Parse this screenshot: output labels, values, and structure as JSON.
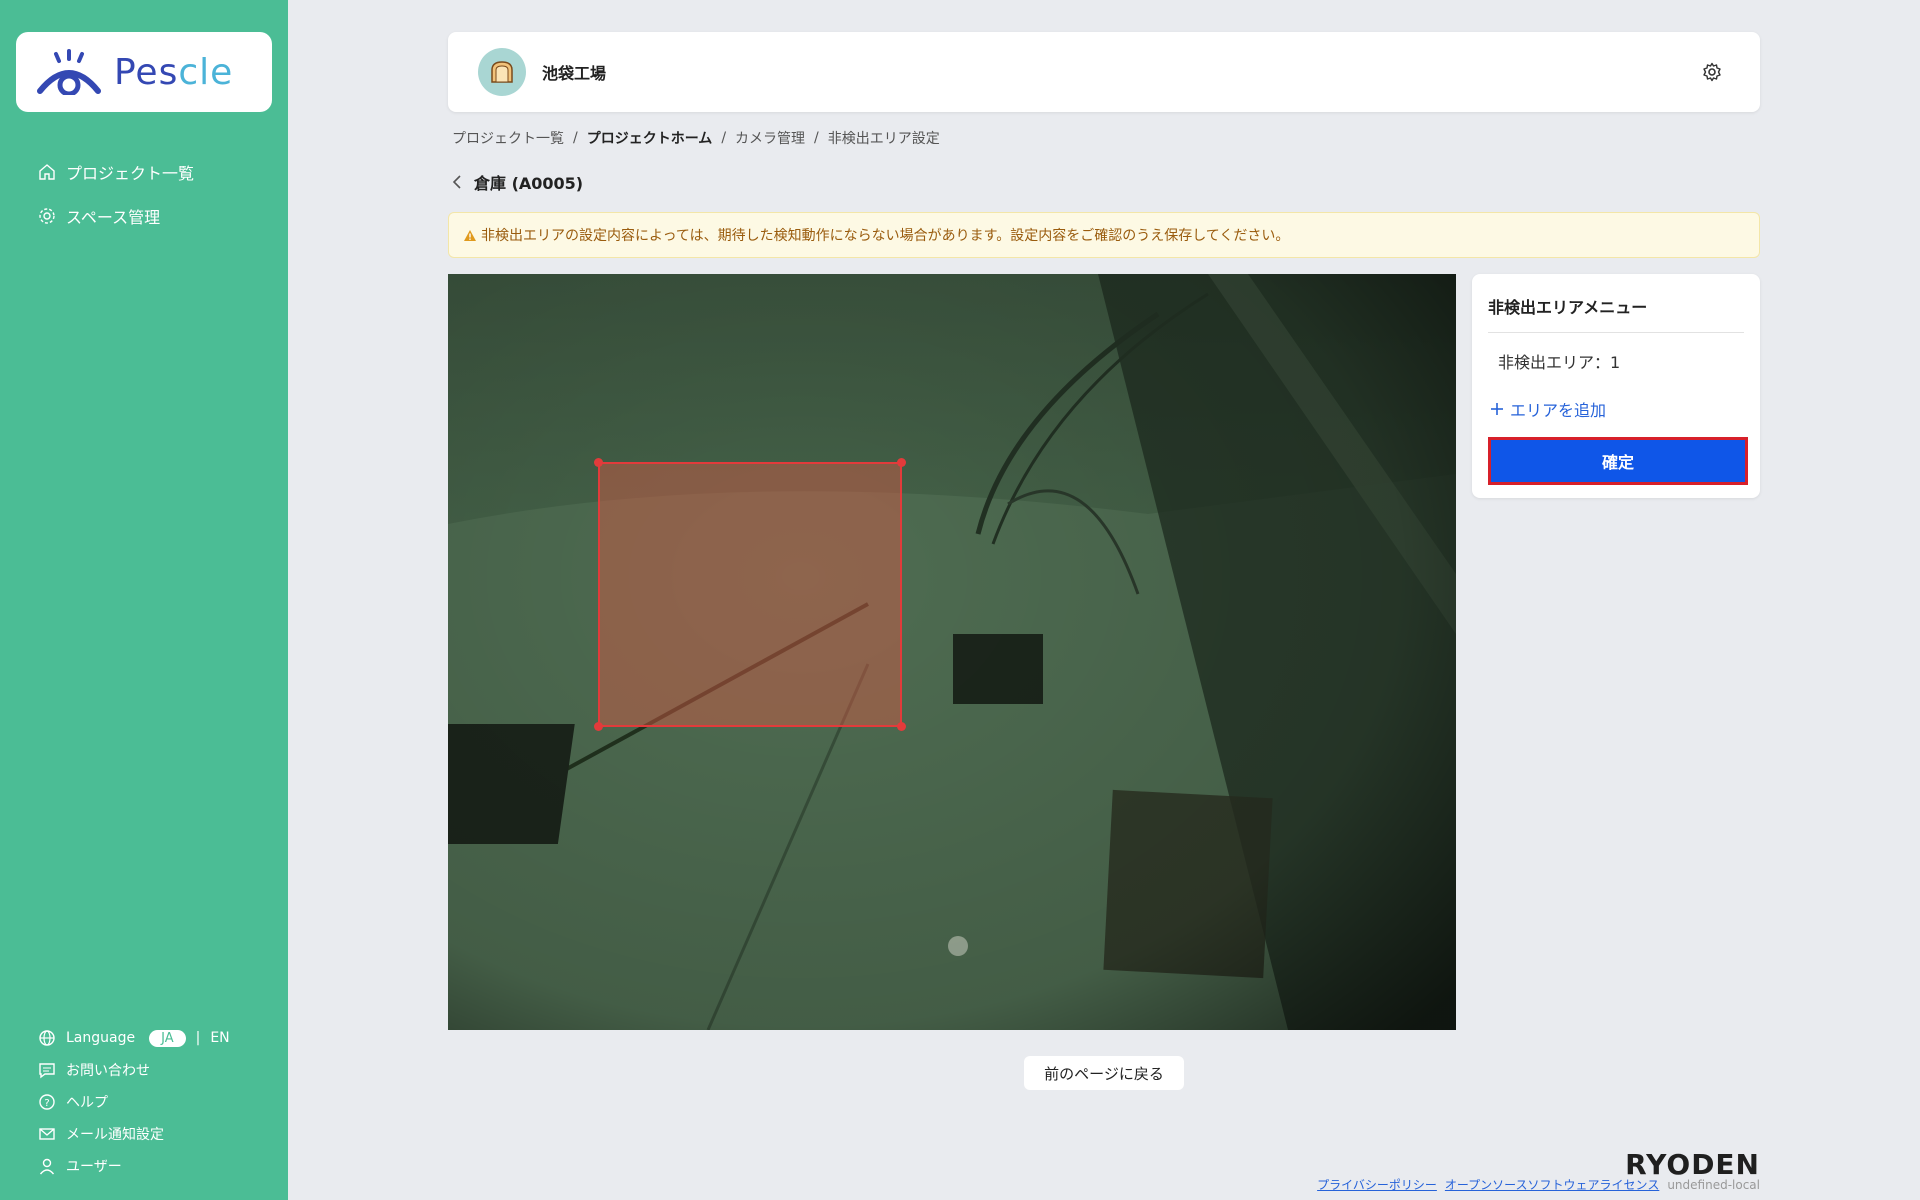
{
  "sidebar": {
    "logo_text_main": "Pes",
    "logo_text_accent": "cle",
    "nav": [
      {
        "label": "プロジェクト一覧",
        "icon": "home-icon"
      },
      {
        "label": "スペース管理",
        "icon": "gear-icon"
      }
    ],
    "language": {
      "label": "Language",
      "options": [
        "JA",
        "EN"
      ],
      "selected": "JA",
      "separator": "|"
    },
    "bottom_nav": [
      {
        "label": "お問い合わせ",
        "icon": "chat-icon"
      },
      {
        "label": "ヘルプ",
        "icon": "help-icon"
      },
      {
        "label": "メール通知設定",
        "icon": "mail-icon"
      },
      {
        "label": "ユーザー",
        "icon": "user-icon"
      }
    ]
  },
  "header": {
    "project_name": "池袋工場",
    "avatar_icon": "bread-icon"
  },
  "breadcrumb": {
    "items": [
      "プロジェクト一覧",
      "プロジェクトホーム",
      "カメラ管理",
      "非検出エリア設定"
    ],
    "separator": "/"
  },
  "camera": {
    "title": "倉庫 (A0005)"
  },
  "warning": {
    "text": "非検出エリアの設定内容によっては、期待した検知動作にならない場合があります。設定内容をご確認のうえ保存してください。"
  },
  "menu": {
    "title": "非検出エリアメニュー",
    "area_item": "非検出エリア：1",
    "add_area": "エリアを追加",
    "confirm": "確定"
  },
  "back_button": "前のページに戻る",
  "footer": {
    "brand": "RYODEN",
    "links": [
      "プライバシーポリシー",
      "オープンソースソフトウェアライセンス"
    ],
    "env": "undefined-local"
  },
  "colors": {
    "sidebar": "#4bbd95",
    "primary": "#0f56e8",
    "area": "#e23b3b",
    "warning_bg": "#fdf9e4",
    "warning_text": "#9a5c0e"
  }
}
